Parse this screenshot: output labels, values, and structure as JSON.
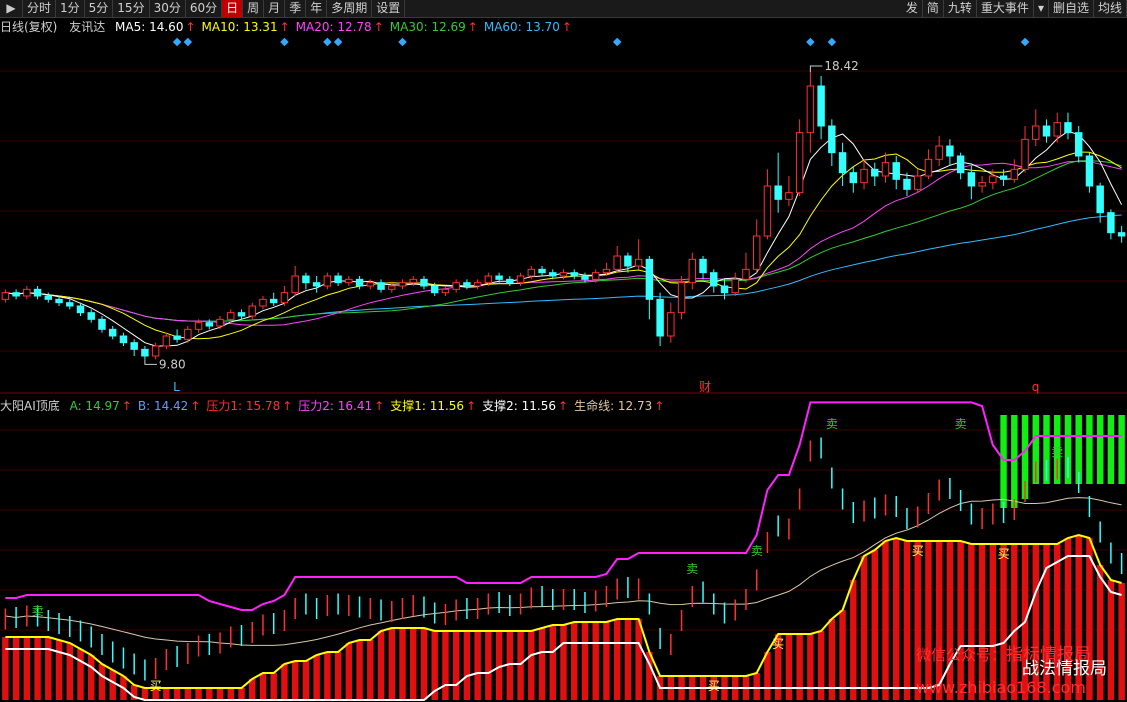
{
  "toolbar": {
    "items": [
      "分时",
      "1分",
      "5分",
      "15分",
      "30分",
      "60分",
      "日",
      "周",
      "月",
      "季",
      "年",
      "多周期",
      "设置"
    ],
    "active": "日",
    "right_items": [
      "发",
      "简",
      "九转",
      "重大事件",
      "删自选",
      "均线"
    ],
    "dropdown_glyph": "▾"
  },
  "main_info": {
    "title": "日线(复权)",
    "stock": "友讯达",
    "ma": [
      {
        "label": "MA5:",
        "value": "14.60",
        "color": "#ffffff"
      },
      {
        "label": "MA10:",
        "value": "13.31",
        "color": "#ffff00"
      },
      {
        "label": "MA20:",
        "value": "12.78",
        "color": "#ff44ff"
      },
      {
        "label": "MA30:",
        "value": "12.69",
        "color": "#33cc33"
      },
      {
        "label": "MA60:",
        "value": "13.70",
        "color": "#33bbff"
      }
    ],
    "arrow": "↑"
  },
  "sub_info": {
    "name": "大阳AI顶底",
    "items": [
      {
        "label": "A:",
        "value": "14.97",
        "color": "#33cc33"
      },
      {
        "label": "B:",
        "value": "14.42",
        "color": "#6699ff"
      },
      {
        "label": "压力1:",
        "value": "15.78",
        "color": "#ff3030"
      },
      {
        "label": "压力2:",
        "value": "16.41",
        "color": "#ff44ff"
      },
      {
        "label": "支撑1:",
        "value": "11.56",
        "color": "#ffff00"
      },
      {
        "label": "支撑2:",
        "value": "11.56",
        "color": "#ffffff"
      },
      {
        "label": "生命线:",
        "value": "12.73",
        "color": "#e0c8a0"
      }
    ],
    "arrow": "↑"
  },
  "colors": {
    "up": "#ff3030",
    "down": "#33ffff",
    "ma5": "#ffffff",
    "ma10": "#ffff00",
    "ma20": "#ff44ff",
    "ma30": "#33cc33",
    "ma60": "#33bbff",
    "grid": "#3a0000",
    "pressure": "#ff22ff",
    "support_fill": "#e01010",
    "support_line": "#ffff00",
    "lifeline": "#d8c8a8",
    "bottom_line": "#ffffff",
    "green_fill": "#11ee11"
  },
  "annotations": {
    "high_label": "18.42",
    "low_label": "9.80",
    "markers": [
      {
        "text": "L",
        "color": "#33bbff"
      },
      {
        "text": "财",
        "color": "#ff3030"
      },
      {
        "text": "q",
        "color": "#ff3030"
      }
    ],
    "signals": [
      {
        "text": "卖",
        "color": "#33cc33"
      },
      {
        "text": "买",
        "color": "#ffff66"
      },
      {
        "text": "卖",
        "color": "#33cc33"
      },
      {
        "text": "买",
        "color": "#ffff66"
      },
      {
        "text": "卖",
        "color": "#33cc33"
      },
      {
        "text": "买",
        "color": "#ffff66"
      },
      {
        "text": "卖",
        "color": "#33cc33"
      },
      {
        "text": "买",
        "color": "#ffff66"
      },
      {
        "text": "卖",
        "color": "#33cc33"
      },
      {
        "text": "买",
        "color": "#ffff66"
      },
      {
        "text": "卖",
        "color": "#33cc33"
      }
    ]
  },
  "watermark": {
    "line1a": "微信公众号：",
    "line1b": "指标情报局",
    "line2": "战法情报局",
    "url": "www.zhibiao168.com"
  },
  "chart_data": {
    "type": "candlestick",
    "price_range": [
      9.0,
      19.5
    ],
    "grid": true,
    "candles": [
      [
        11.6,
        11.8,
        11.9,
        11.5
      ],
      [
        11.8,
        11.7,
        11.9,
        11.6
      ],
      [
        11.7,
        11.9,
        12.0,
        11.6
      ],
      [
        11.9,
        11.7,
        12.0,
        11.6
      ],
      [
        11.7,
        11.6,
        11.8,
        11.5
      ],
      [
        11.6,
        11.5,
        11.7,
        11.4
      ],
      [
        11.5,
        11.4,
        11.6,
        11.3
      ],
      [
        11.4,
        11.2,
        11.5,
        11.1
      ],
      [
        11.2,
        11.0,
        11.3,
        10.9
      ],
      [
        11.0,
        10.7,
        11.1,
        10.6
      ],
      [
        10.7,
        10.5,
        10.8,
        10.4
      ],
      [
        10.5,
        10.3,
        10.6,
        10.2
      ],
      [
        10.3,
        10.1,
        10.4,
        9.9
      ],
      [
        10.1,
        9.9,
        10.2,
        9.8
      ],
      [
        9.9,
        10.2,
        10.3,
        9.8
      ],
      [
        10.2,
        10.5,
        10.6,
        10.1
      ],
      [
        10.5,
        10.4,
        10.7,
        10.3
      ],
      [
        10.4,
        10.7,
        10.8,
        10.3
      ],
      [
        10.7,
        10.9,
        11.0,
        10.6
      ],
      [
        10.9,
        10.8,
        11.0,
        10.7
      ],
      [
        10.8,
        11.0,
        11.1,
        10.7
      ],
      [
        11.0,
        11.2,
        11.3,
        10.9
      ],
      [
        11.2,
        11.1,
        11.3,
        11.0
      ],
      [
        11.1,
        11.4,
        11.5,
        11.0
      ],
      [
        11.4,
        11.6,
        11.7,
        11.3
      ],
      [
        11.6,
        11.5,
        11.8,
        11.4
      ],
      [
        11.5,
        11.8,
        12.0,
        11.4
      ],
      [
        11.8,
        12.3,
        12.6,
        11.7
      ],
      [
        12.3,
        12.1,
        12.4,
        11.9
      ],
      [
        12.1,
        12.0,
        12.3,
        11.8
      ],
      [
        12.0,
        12.3,
        12.4,
        11.9
      ],
      [
        12.3,
        12.1,
        12.4,
        12.0
      ],
      [
        12.1,
        12.2,
        12.3,
        12.0
      ],
      [
        12.2,
        12.0,
        12.3,
        11.9
      ],
      [
        12.0,
        12.1,
        12.2,
        11.9
      ],
      [
        12.1,
        11.9,
        12.2,
        11.8
      ],
      [
        11.9,
        12.0,
        12.1,
        11.8
      ],
      [
        12.0,
        12.1,
        12.2,
        11.9
      ],
      [
        12.1,
        12.2,
        12.3,
        12.0
      ],
      [
        12.2,
        12.0,
        12.3,
        11.9
      ],
      [
        12.0,
        11.8,
        12.1,
        11.7
      ],
      [
        11.8,
        11.9,
        12.0,
        11.7
      ],
      [
        11.9,
        12.1,
        12.2,
        11.8
      ],
      [
        12.1,
        12.0,
        12.2,
        11.9
      ],
      [
        12.0,
        12.1,
        12.2,
        11.9
      ],
      [
        12.1,
        12.3,
        12.4,
        12.0
      ],
      [
        12.3,
        12.2,
        12.4,
        12.1
      ],
      [
        12.2,
        12.1,
        12.3,
        12.0
      ],
      [
        12.1,
        12.3,
        12.4,
        12.0
      ],
      [
        12.3,
        12.5,
        12.6,
        12.2
      ],
      [
        12.5,
        12.4,
        12.6,
        12.3
      ],
      [
        12.4,
        12.3,
        12.5,
        12.2
      ],
      [
        12.3,
        12.4,
        12.5,
        12.2
      ],
      [
        12.4,
        12.3,
        12.5,
        12.2
      ],
      [
        12.3,
        12.2,
        12.4,
        12.1
      ],
      [
        12.2,
        12.4,
        12.5,
        12.1
      ],
      [
        12.4,
        12.5,
        12.7,
        12.3
      ],
      [
        12.5,
        12.9,
        13.2,
        12.4
      ],
      [
        12.9,
        12.6,
        13.0,
        12.4
      ],
      [
        12.6,
        12.8,
        13.4,
        12.5
      ],
      [
        12.8,
        11.6,
        12.9,
        11.0
      ],
      [
        11.6,
        10.5,
        11.8,
        10.2
      ],
      [
        10.5,
        11.2,
        11.5,
        10.3
      ],
      [
        11.2,
        12.1,
        12.3,
        11.0
      ],
      [
        12.1,
        12.8,
        13.0,
        11.9
      ],
      [
        12.8,
        12.4,
        12.9,
        12.2
      ],
      [
        12.4,
        12.0,
        12.5,
        11.8
      ],
      [
        12.0,
        11.8,
        12.2,
        11.6
      ],
      [
        11.8,
        12.2,
        12.4,
        11.7
      ],
      [
        12.2,
        12.5,
        13.0,
        12.1
      ],
      [
        12.5,
        13.5,
        14.0,
        12.4
      ],
      [
        13.5,
        15.0,
        15.5,
        13.4
      ],
      [
        15.0,
        14.6,
        16.0,
        14.2
      ],
      [
        14.6,
        14.8,
        15.3,
        14.4
      ],
      [
        14.8,
        16.6,
        17.0,
        14.7
      ],
      [
        16.6,
        18.0,
        18.42,
        16.0
      ],
      [
        18.0,
        16.8,
        18.3,
        16.4
      ],
      [
        16.8,
        16.0,
        17.0,
        15.6
      ],
      [
        16.0,
        15.4,
        16.3,
        15.0
      ],
      [
        15.4,
        15.1,
        15.6,
        14.8
      ],
      [
        15.1,
        15.5,
        15.8,
        14.9
      ],
      [
        15.5,
        15.3,
        15.7,
        15.0
      ],
      [
        15.3,
        15.7,
        16.0,
        15.1
      ],
      [
        15.7,
        15.2,
        15.9,
        14.9
      ],
      [
        15.2,
        14.9,
        15.4,
        14.7
      ],
      [
        14.9,
        15.3,
        15.5,
        14.8
      ],
      [
        15.3,
        15.8,
        16.1,
        15.2
      ],
      [
        15.8,
        16.2,
        16.5,
        15.6
      ],
      [
        16.2,
        15.9,
        16.4,
        15.6
      ],
      [
        15.9,
        15.4,
        16.0,
        15.2
      ],
      [
        15.4,
        15.0,
        15.6,
        14.6
      ],
      [
        15.0,
        15.1,
        15.3,
        14.8
      ],
      [
        15.1,
        15.3,
        15.5,
        14.9
      ],
      [
        15.3,
        15.2,
        15.5,
        15.0
      ],
      [
        15.2,
        15.5,
        15.8,
        15.1
      ],
      [
        15.5,
        16.4,
        16.8,
        15.4
      ],
      [
        16.4,
        16.8,
        17.3,
        16.2
      ],
      [
        16.8,
        16.5,
        17.0,
        16.3
      ],
      [
        16.5,
        16.9,
        17.2,
        16.3
      ],
      [
        16.9,
        16.6,
        17.2,
        16.4
      ],
      [
        16.6,
        15.9,
        16.8,
        15.7
      ],
      [
        15.9,
        15.0,
        16.0,
        14.8
      ],
      [
        15.0,
        14.2,
        15.1,
        13.9
      ],
      [
        14.2,
        13.6,
        14.3,
        13.4
      ],
      [
        13.6,
        13.5,
        13.8,
        13.3
      ]
    ],
    "low_point": "9.80",
    "high_point": "18.42"
  }
}
